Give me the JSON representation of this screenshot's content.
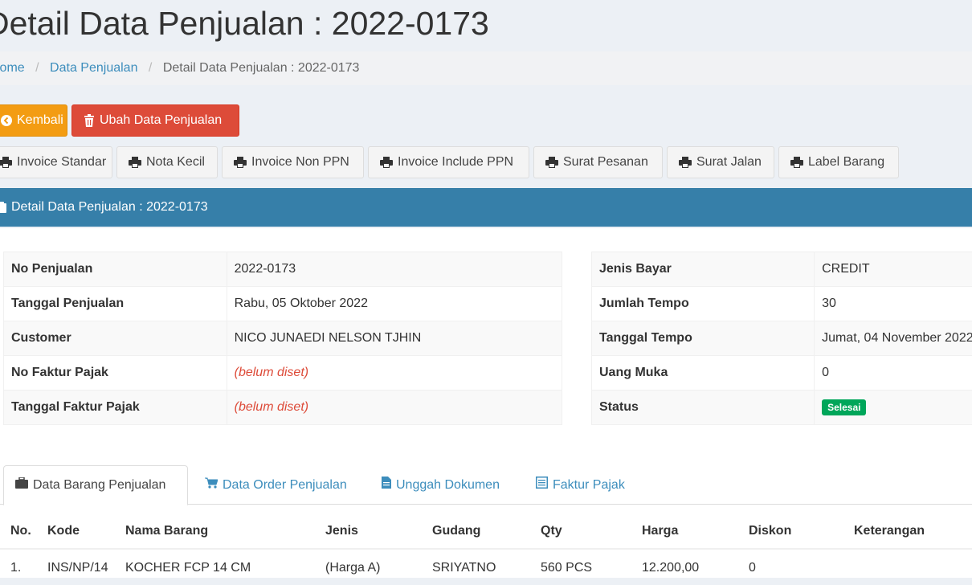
{
  "page": {
    "title": "Detail Data Penjualan : 2022-0173"
  },
  "breadcrumb": {
    "home": "Home",
    "section": "Data Penjualan",
    "current": "Detail Data Penjualan : 2022-0173"
  },
  "actions": {
    "back": "Kembali",
    "edit": "Ubah Data Penjualan"
  },
  "print_buttons": [
    "Invoice Standar",
    "Nota Kecil",
    "Invoice Non PPN",
    "Invoice Include PPN",
    "Surat Pesanan",
    "Surat Jalan",
    "Label Barang"
  ],
  "box": {
    "header": "Detail Data Penjualan : 2022-0173"
  },
  "info_left": [
    {
      "label": "No Penjualan",
      "value": "2022-0173"
    },
    {
      "label": "Tanggal Penjualan",
      "value": "Rabu, 05 Oktober 2022"
    },
    {
      "label": "Customer",
      "value": "NICO JUNAEDI NELSON TJHIN"
    },
    {
      "label": "No Faktur Pajak",
      "value": "(belum diset)"
    },
    {
      "label": "Tanggal Faktur Pajak",
      "value": "(belum diset)"
    }
  ],
  "info_right": [
    {
      "label": "Jenis Bayar",
      "value": "CREDIT"
    },
    {
      "label": "Jumlah Tempo",
      "value": "30"
    },
    {
      "label": "Tanggal Tempo",
      "value": "Jumat, 04 November 2022"
    },
    {
      "label": "Uang Muka",
      "value": "0"
    },
    {
      "label": "Status",
      "value": "Selesai"
    }
  ],
  "tabs": [
    {
      "label": "Data Barang Penjualan",
      "icon": "briefcase-icon"
    },
    {
      "label": "Data Order Penjualan",
      "icon": "cart-icon"
    },
    {
      "label": "Unggah Dokumen",
      "icon": "file-icon"
    },
    {
      "label": "Faktur Pajak",
      "icon": "list-icon"
    }
  ],
  "items_table": {
    "headers": [
      "No.",
      "Kode",
      "Nama Barang",
      "Jenis",
      "Gudang",
      "Qty",
      "Harga",
      "Diskon",
      "Keterangan"
    ],
    "rows": [
      [
        "1.",
        "INS/NP/14",
        "KOCHER FCP 14 CM",
        "(Harga A)",
        "SRIYATNO",
        "560 PCS",
        "12.200,00",
        "0",
        ""
      ]
    ]
  },
  "colors": {
    "primary": "#367fa9",
    "warning": "#f39c12",
    "danger": "#dd4b39",
    "success": "#00a65a",
    "link": "#3c8dbc"
  }
}
